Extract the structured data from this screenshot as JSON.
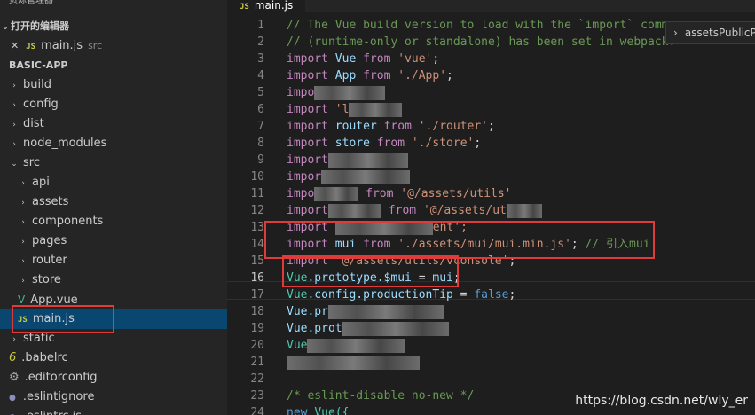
{
  "sidebar": {
    "title": "资源管理器",
    "open_editors": {
      "header": "打开的编辑器",
      "items": [
        {
          "close": "✕",
          "icon": "JS",
          "name": "main.js",
          "path": "src"
        }
      ]
    },
    "project": {
      "header": "BASIC-APP",
      "items": [
        {
          "label": "build",
          "chev": "›"
        },
        {
          "label": "config",
          "chev": "›"
        },
        {
          "label": "dist",
          "chev": "›"
        },
        {
          "label": "node_modules",
          "chev": "›"
        },
        {
          "label": "src",
          "chev": "⌄"
        },
        {
          "label": "api",
          "chev": "›"
        },
        {
          "label": "assets",
          "chev": "›"
        },
        {
          "label": "components",
          "chev": "›"
        },
        {
          "label": "pages",
          "chev": "›"
        },
        {
          "label": "router",
          "chev": "›"
        },
        {
          "label": "store",
          "chev": "›"
        },
        {
          "label": "App.vue",
          "icon": "V"
        },
        {
          "label": "main.js",
          "icon": "JS"
        },
        {
          "label": "static",
          "chev": "›"
        },
        {
          "label": ".babelrc",
          "icon": "6"
        },
        {
          "label": ".editorconfig",
          "icon": "⚙"
        },
        {
          "label": ".eslintignore",
          "icon": "●"
        },
        {
          "label": ".eslintrc.js",
          "icon": "●"
        }
      ]
    }
  },
  "tab": {
    "icon": "JS",
    "label": "main.js"
  },
  "breadcrumb": {
    "chev": "›",
    "label": "assetsPublicP"
  },
  "code": {
    "lines": [
      {
        "n": "1"
      },
      {
        "n": "2"
      },
      {
        "n": "3"
      },
      {
        "n": "4"
      },
      {
        "n": "5"
      },
      {
        "n": "6"
      },
      {
        "n": "7"
      },
      {
        "n": "8"
      },
      {
        "n": "9"
      },
      {
        "n": "10"
      },
      {
        "n": "11"
      },
      {
        "n": "12"
      },
      {
        "n": "13"
      },
      {
        "n": "14"
      },
      {
        "n": "15"
      },
      {
        "n": "16"
      },
      {
        "n": "17"
      },
      {
        "n": "18"
      },
      {
        "n": "19"
      },
      {
        "n": "20"
      },
      {
        "n": "21"
      },
      {
        "n": "22"
      },
      {
        "n": "23"
      },
      {
        "n": "24"
      }
    ],
    "t": {
      "c1": "// The Vue build version to load with the `import` comma",
      "c2": "// (runtime-only or standalone) has been set in webpack.",
      "import": "import",
      "from": "from",
      "vue": "Vue",
      "vue_s": "'vue'",
      "app": "App",
      "app_s": "'./App'",
      "impo": "impo",
      "l5_tail": "",
      "l6_s": "'l",
      "router": "router",
      "router_s": "'./router'",
      "store": "store",
      "store_s": "'./store'",
      "l8": "import",
      "l9": "impor",
      "l10": "impo",
      "l10_from": "from",
      "l10_s": "'@/assets/utils'",
      "l11": "import",
      "l11_from": "from",
      "l11_s": "'@/assets/ut",
      "l12": "import",
      "l12_s": "ent';",
      "mui": "mui",
      "mui_s": "'./assets/mui/mui.min.js'",
      "mui_cm": "// 引入mui",
      "l15_s": "'@/assets/utils/vconsole'",
      "vue16": "Vue",
      "proto": ".prototype.",
      "mui16": "$mui",
      "eq": " = ",
      "mui16b": "mui",
      "semi": ";",
      "config": ".config.",
      "tip": "productionTip",
      "false": "false",
      "l18": "Vue.pr",
      "l19": "Vue.prot",
      "l20": "Vue",
      "l21": "",
      "c23": "/* eslint-disable no-new */",
      "new": "new",
      "newvue": "Vue({"
    }
  },
  "watermark": "https://blog.csdn.net/wly_er"
}
